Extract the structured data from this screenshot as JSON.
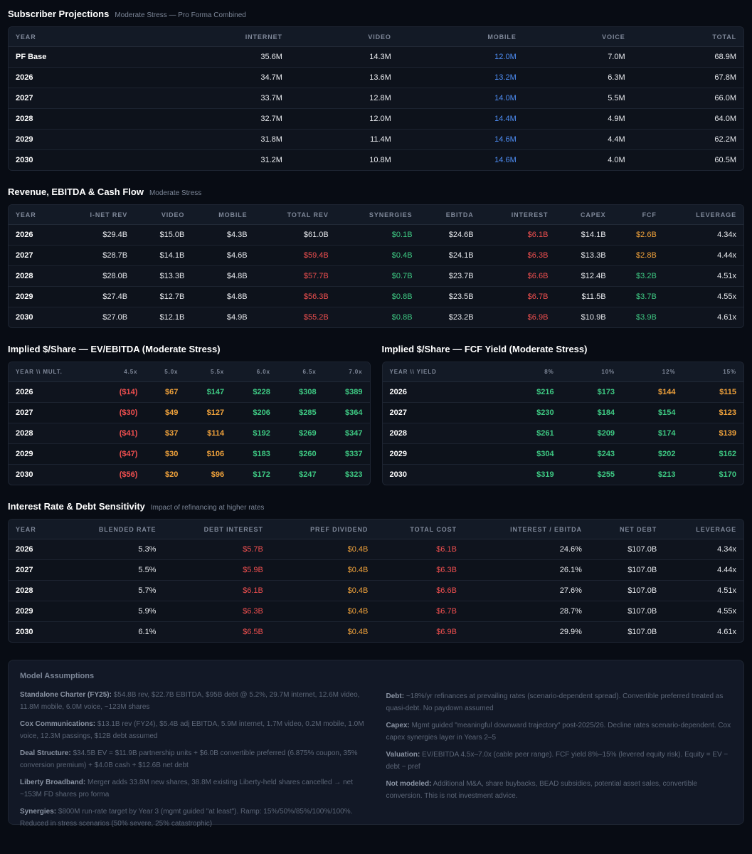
{
  "subscriber": {
    "title": "Subscriber Projections",
    "subtitle": "Moderate Stress — Pro Forma Combined",
    "headers": [
      "YEAR",
      "INTERNET",
      "VIDEO",
      "MOBILE",
      "VOICE",
      "TOTAL"
    ],
    "rows": [
      [
        "PF Base",
        "35.6M",
        "14.3M",
        "12.0M",
        "7.0M",
        "68.9M"
      ],
      [
        "2026",
        "34.7M",
        "13.6M",
        "13.2M",
        "6.3M",
        "67.8M"
      ],
      [
        "2027",
        "33.7M",
        "12.8M",
        "14.0M",
        "5.5M",
        "66.0M"
      ],
      [
        "2028",
        "32.7M",
        "12.0M",
        "14.4M",
        "4.9M",
        "64.0M"
      ],
      [
        "2029",
        "31.8M",
        "11.4M",
        "14.6M",
        "4.4M",
        "62.2M"
      ],
      [
        "2030",
        "31.2M",
        "10.8M",
        "14.6M",
        "4.0M",
        "60.5M"
      ]
    ]
  },
  "revenue": {
    "title": "Revenue, EBITDA & Cash Flow",
    "subtitle": "Moderate Stress",
    "headers": [
      "YEAR",
      "I-NET REV",
      "VIDEO",
      "MOBILE",
      "TOTAL REV",
      "SYNERGIES",
      "EBITDA",
      "INTEREST",
      "CAPEX",
      "FCF",
      "LEVERAGE"
    ],
    "rows": [
      [
        "2026",
        "$29.4B",
        "$15.0B",
        "$4.3B",
        "$61.0B",
        "$0.1B",
        "$24.6B",
        "$6.1B",
        "$14.1B",
        "$2.6B",
        "4.34x"
      ],
      [
        "2027",
        "$28.7B",
        "$14.1B",
        "$4.6B",
        "$59.4B",
        "$0.4B",
        "$24.1B",
        "$6.3B",
        "$13.3B",
        "$2.8B",
        "4.44x"
      ],
      [
        "2028",
        "$28.0B",
        "$13.3B",
        "$4.8B",
        "$57.7B",
        "$0.7B",
        "$23.7B",
        "$6.6B",
        "$12.4B",
        "$3.2B",
        "4.51x"
      ],
      [
        "2029",
        "$27.4B",
        "$12.7B",
        "$4.8B",
        "$56.3B",
        "$0.8B",
        "$23.5B",
        "$6.7B",
        "$11.5B",
        "$3.7B",
        "4.55x"
      ],
      [
        "2030",
        "$27.0B",
        "$12.1B",
        "$4.9B",
        "$55.2B",
        "$0.8B",
        "$23.2B",
        "$6.9B",
        "$10.9B",
        "$3.9B",
        "4.61x"
      ]
    ],
    "fcf_colors": [
      "orange",
      "orange",
      "green",
      "green",
      "green"
    ],
    "total_rev_colors": [
      "",
      "red",
      "red",
      "red",
      "red"
    ]
  },
  "ev_ebitda": {
    "title": "Implied $/Share — EV/EBITDA (Moderate Stress)",
    "headers": [
      "YEAR \\\\ MULT.",
      "4.5x",
      "5.0x",
      "5.5x",
      "6.0x",
      "6.5x",
      "7.0x"
    ],
    "rows": [
      [
        "2026",
        "($14)",
        "$67",
        "$147",
        "$228",
        "$308",
        "$389"
      ],
      [
        "2027",
        "($30)",
        "$49",
        "$127",
        "$206",
        "$285",
        "$364"
      ],
      [
        "2028",
        "($41)",
        "$37",
        "$114",
        "$192",
        "$269",
        "$347"
      ],
      [
        "2029",
        "($47)",
        "$30",
        "$106",
        "$183",
        "$260",
        "$337"
      ],
      [
        "2030",
        "($56)",
        "$20",
        "$96",
        "$172",
        "$247",
        "$323"
      ]
    ],
    "colors": [
      [
        "red",
        "orange",
        "green",
        "green",
        "green",
        "green"
      ],
      [
        "red",
        "orange",
        "orange",
        "green",
        "green",
        "green"
      ],
      [
        "red",
        "orange",
        "orange",
        "green",
        "green",
        "green"
      ],
      [
        "red",
        "orange",
        "orange",
        "green",
        "green",
        "green"
      ],
      [
        "red",
        "orange",
        "orange",
        "green",
        "green",
        "green"
      ]
    ]
  },
  "fcf_yield": {
    "title": "Implied $/Share — FCF Yield (Moderate Stress)",
    "headers": [
      "YEAR \\\\ YIELD",
      "8%",
      "10%",
      "12%",
      "15%"
    ],
    "rows": [
      [
        "2026",
        "$216",
        "$173",
        "$144",
        "$115"
      ],
      [
        "2027",
        "$230",
        "$184",
        "$154",
        "$123"
      ],
      [
        "2028",
        "$261",
        "$209",
        "$174",
        "$139"
      ],
      [
        "2029",
        "$304",
        "$243",
        "$202",
        "$162"
      ],
      [
        "2030",
        "$319",
        "$255",
        "$213",
        "$170"
      ]
    ],
    "colors": [
      [
        "green",
        "green",
        "orange",
        "orange"
      ],
      [
        "green",
        "green",
        "green",
        "orange"
      ],
      [
        "green",
        "green",
        "green",
        "orange"
      ],
      [
        "green",
        "green",
        "green",
        "green"
      ],
      [
        "green",
        "green",
        "green",
        "green"
      ]
    ]
  },
  "interest": {
    "title": "Interest Rate & Debt Sensitivity",
    "subtitle": "Impact of refinancing at higher rates",
    "headers": [
      "YEAR",
      "BLENDED RATE",
      "DEBT INTEREST",
      "PREF DIVIDEND",
      "TOTAL COST",
      "INTEREST / EBITDA",
      "NET DEBT",
      "LEVERAGE"
    ],
    "rows": [
      [
        "2026",
        "5.3%",
        "$5.7B",
        "$0.4B",
        "$6.1B",
        "24.6%",
        "$107.0B",
        "4.34x"
      ],
      [
        "2027",
        "5.5%",
        "$5.9B",
        "$0.4B",
        "$6.3B",
        "26.1%",
        "$107.0B",
        "4.44x"
      ],
      [
        "2028",
        "5.7%",
        "$6.1B",
        "$0.4B",
        "$6.6B",
        "27.6%",
        "$107.0B",
        "4.51x"
      ],
      [
        "2029",
        "5.9%",
        "$6.3B",
        "$0.4B",
        "$6.7B",
        "28.7%",
        "$107.0B",
        "4.55x"
      ],
      [
        "2030",
        "6.1%",
        "$6.5B",
        "$0.4B",
        "$6.9B",
        "29.9%",
        "$107.0B",
        "4.61x"
      ]
    ]
  },
  "assumptions": {
    "title": "Model Assumptions",
    "left": [
      {
        "label": "Standalone Charter (FY25):",
        "text": "$54.8B rev, $22.7B EBITDA, $95B debt @ 5.2%, 29.7M internet, 12.6M video, 11.8M mobile, 6.0M voice, ~123M shares"
      },
      {
        "label": "Cox Communications:",
        "text": "$13.1B rev (FY24), $5.4B adj EBITDA, 5.9M internet, 1.7M video, 0.2M mobile, 1.0M voice, 12.3M passings, $12B debt assumed"
      },
      {
        "label": "Deal Structure:",
        "text": "$34.5B EV = $11.9B partnership units + $6.0B convertible preferred (6.875% coupon, 35% conversion premium) + $4.0B cash + $12.6B net debt"
      },
      {
        "label": "Liberty Broadband:",
        "text": "Merger adds 33.8M new shares, 38.8M existing Liberty-held shares cancelled → net ~153M FD shares pro forma"
      },
      {
        "label": "Synergies:",
        "text": "$800M run-rate target by Year 3 (mgmt guided \"at least\"). Ramp: 15%/50%/85%/100%/100%. Reduced in stress scenarios (50% severe, 25% catastrophic)"
      }
    ],
    "right": [
      {
        "label": "Debt:",
        "text": "~18%/yr refinances at prevailing rates (scenario-dependent spread). Convertible preferred treated as quasi-debt. No paydown assumed"
      },
      {
        "label": "Capex:",
        "text": "Mgmt guided \"meaningful downward trajectory\" post-2025/26. Decline rates scenario-dependent. Cox capex synergies layer in Years 2–5"
      },
      {
        "label": "Valuation:",
        "text": "EV/EBITDA 4.5x–7.0x (cable peer range). FCF yield 8%–15% (levered equity risk). Equity = EV − debt − pref"
      },
      {
        "label": "Not modeled:",
        "text": "Additional M&A, share buybacks, BEAD subsidies, potential asset sales, convertible conversion. This is not investment advice."
      }
    ]
  }
}
